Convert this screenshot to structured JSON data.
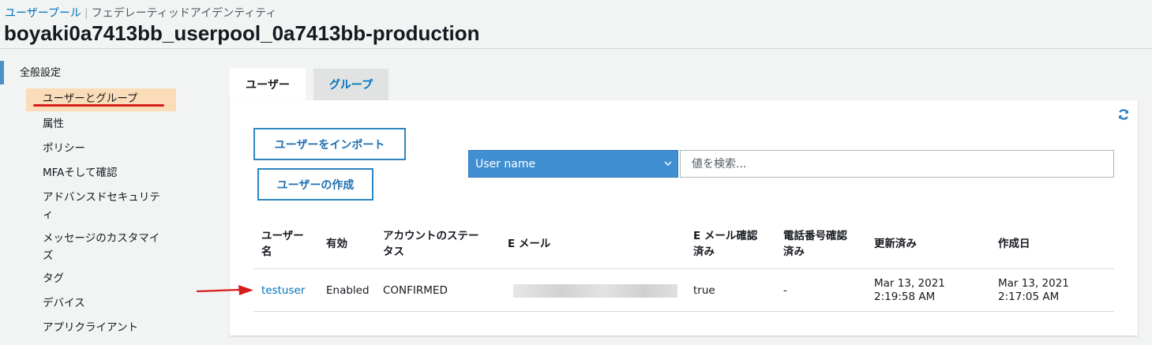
{
  "breadcrumb": {
    "user_pool": "ユーザープール",
    "separator": "|",
    "federated": "フェデレーティッドアイデンティティ"
  },
  "page_title": "boyaki0a7413bb_userpool_0a7413bb-production",
  "sidebar": {
    "section": "全般設定",
    "items": [
      {
        "label": "ユーザーとグループ",
        "active": true
      },
      {
        "label": "属性"
      },
      {
        "label": "ポリシー"
      },
      {
        "label": "MFAそして確認"
      },
      {
        "label": "アドバンスドセキュリティ"
      },
      {
        "label": "メッセージのカスタマイズ"
      },
      {
        "label": "タグ"
      },
      {
        "label": "デバイス"
      },
      {
        "label": "アプリクライアント"
      }
    ]
  },
  "tabs": [
    {
      "label": "ユーザー",
      "active": true
    },
    {
      "label": "グループ",
      "active": false
    }
  ],
  "actions": {
    "import_label": "ユーザーをインポート",
    "create_label": "ユーザーの作成"
  },
  "filter": {
    "selected": "User name",
    "search_placeholder": "値を検索..."
  },
  "table": {
    "columns": [
      "ユーザー名",
      "有効",
      "アカウントのステータス",
      "E メール",
      "E メール確認済み",
      "電話番号確認済み",
      "更新済み",
      "作成日"
    ],
    "rows": [
      {
        "username": "testuser",
        "enabled": "Enabled",
        "status": "CONFIRMED",
        "email_verified": "true",
        "phone_verified": "-",
        "updated": "Mar 13, 2021 2:19:58 AM",
        "created": "Mar 13, 2021 2:17:05 AM"
      }
    ]
  },
  "icons": {
    "refresh": "refresh-icon",
    "dropdown": "chevron-down-icon",
    "annotation": "red-arrow-icon"
  },
  "colors": {
    "link": "#0073bb",
    "select_bg": "#3f8fd2",
    "highlight": "#fbdcb8",
    "annotation": "#d51d1d"
  }
}
